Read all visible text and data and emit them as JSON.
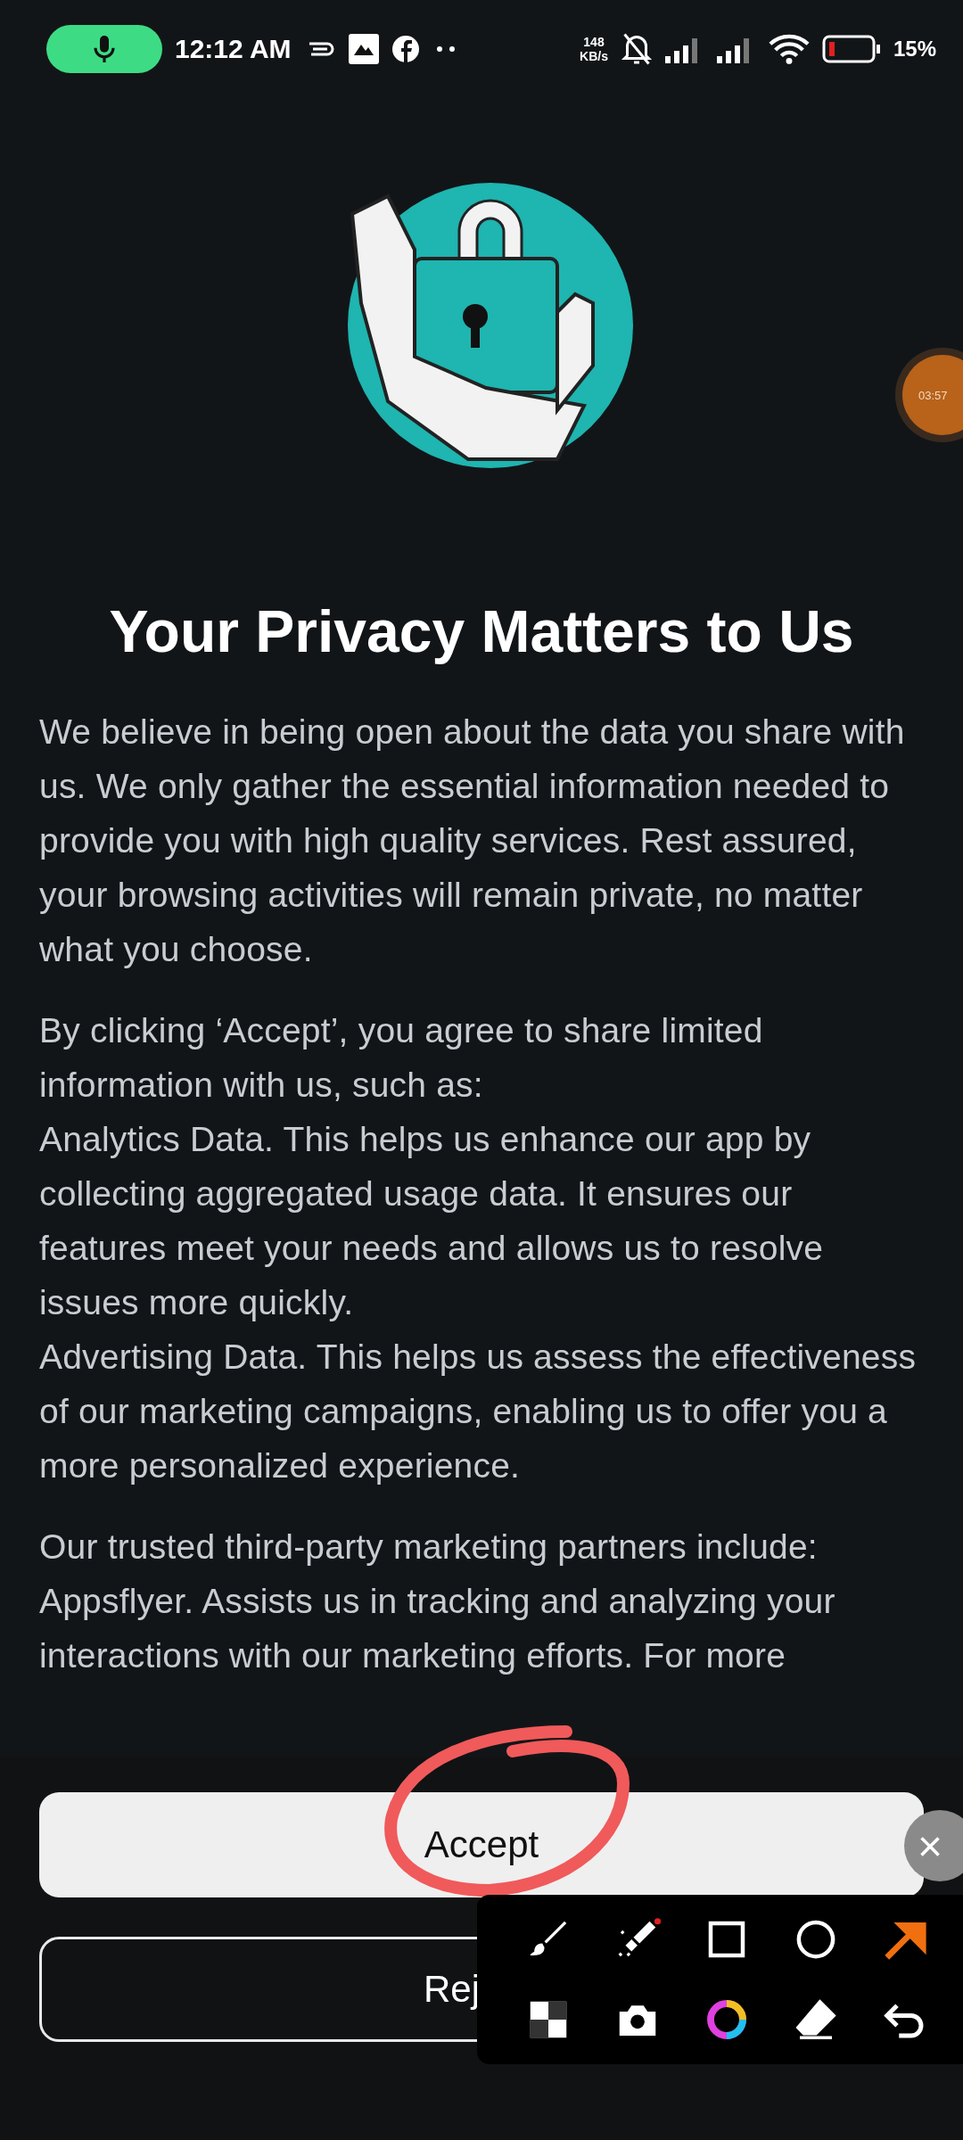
{
  "status_bar": {
    "time": "12:12 AM",
    "speed": "148",
    "speed_unit": "KB/s",
    "battery": "15%"
  },
  "timer_bubble": {
    "text": "03:57"
  },
  "title": "Your Privacy Matters to Us",
  "paragraphs": [
    [
      "We believe in being open about the data you share with us. We only gather the essential information needed to provide you with high quality services. Rest assured, your browsing activities will remain private, no matter what you choose."
    ],
    [
      "By clicking ‘Accept’, you agree to share limited information with us, such as:",
      "Analytics Data. This helps us enhance our app by collecting aggregated usage data. It ensures our features meet your needs and allows us to resolve issues more quickly.",
      "Advertising Data. This helps us assess the effectiveness of our marketing campaigns, enabling us to offer you a more personalized experience."
    ],
    [
      "Our trusted third-party marketing partners include:",
      "Appsflyer. Assists us in tracking and analyzing your interactions with our marketing efforts. For more"
    ]
  ],
  "buttons": [
    {
      "label": "Accept",
      "kind": "filled"
    },
    {
      "label": "Rej",
      "kind": "outlined"
    }
  ],
  "close_button": "×"
}
